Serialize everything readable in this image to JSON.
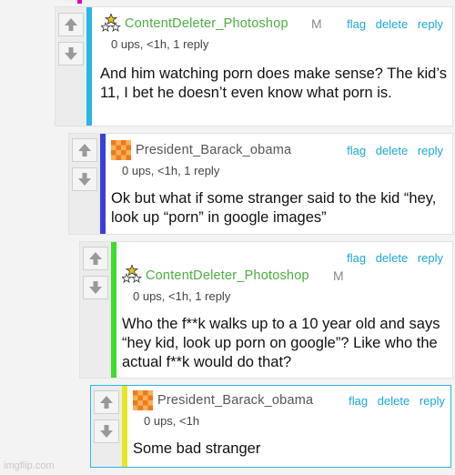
{
  "comments": [
    {
      "username": "ContentDeleter_Photoshop",
      "badge": "M",
      "avatar": "stars-avatar",
      "meta": "0 ups, <1h, 1 reply",
      "actions": {
        "flag": "flag",
        "delete": "delete",
        "reply": "reply"
      },
      "body": "And him watching porn does make sense? The kid’s 11, I bet he doesn’t even know what porn is.",
      "accent_color": "#29b6e8",
      "username_color": "#4cae3f"
    },
    {
      "username": "President_Barack_obama",
      "avatar": "orange-checker-avatar",
      "meta": "0 ups, <1h, 1 reply",
      "actions": {
        "flag": "flag",
        "delete": "delete",
        "reply": "reply"
      },
      "body": "Ok but what if some stranger said to the kid “hey, look up “porn” in google images”",
      "accent_color": "#3a3fdc",
      "username_color": "#555555"
    },
    {
      "username": "ContentDeleter_Photoshop",
      "badge": "M",
      "avatar": "stars-avatar",
      "meta": "0 ups, <1h, 1 reply",
      "actions": {
        "flag": "flag",
        "delete": "delete",
        "reply": "reply"
      },
      "body": "Who the f**k walks up to a 10 year old and says “hey kid, look up porn on google”? Like who the actual f**k would do that?",
      "accent_color": "#3fdb2a",
      "username_color": "#4cae3f"
    },
    {
      "username": "President_Barack_obama",
      "avatar": "orange-checker-avatar",
      "meta": "0 ups, <1h",
      "actions": {
        "flag": "flag",
        "delete": "delete",
        "reply": "reply"
      },
      "body": "Some bad stranger",
      "accent_color": "#e6e81e",
      "username_color": "#555555"
    }
  ],
  "watermark": "imgflip.com"
}
